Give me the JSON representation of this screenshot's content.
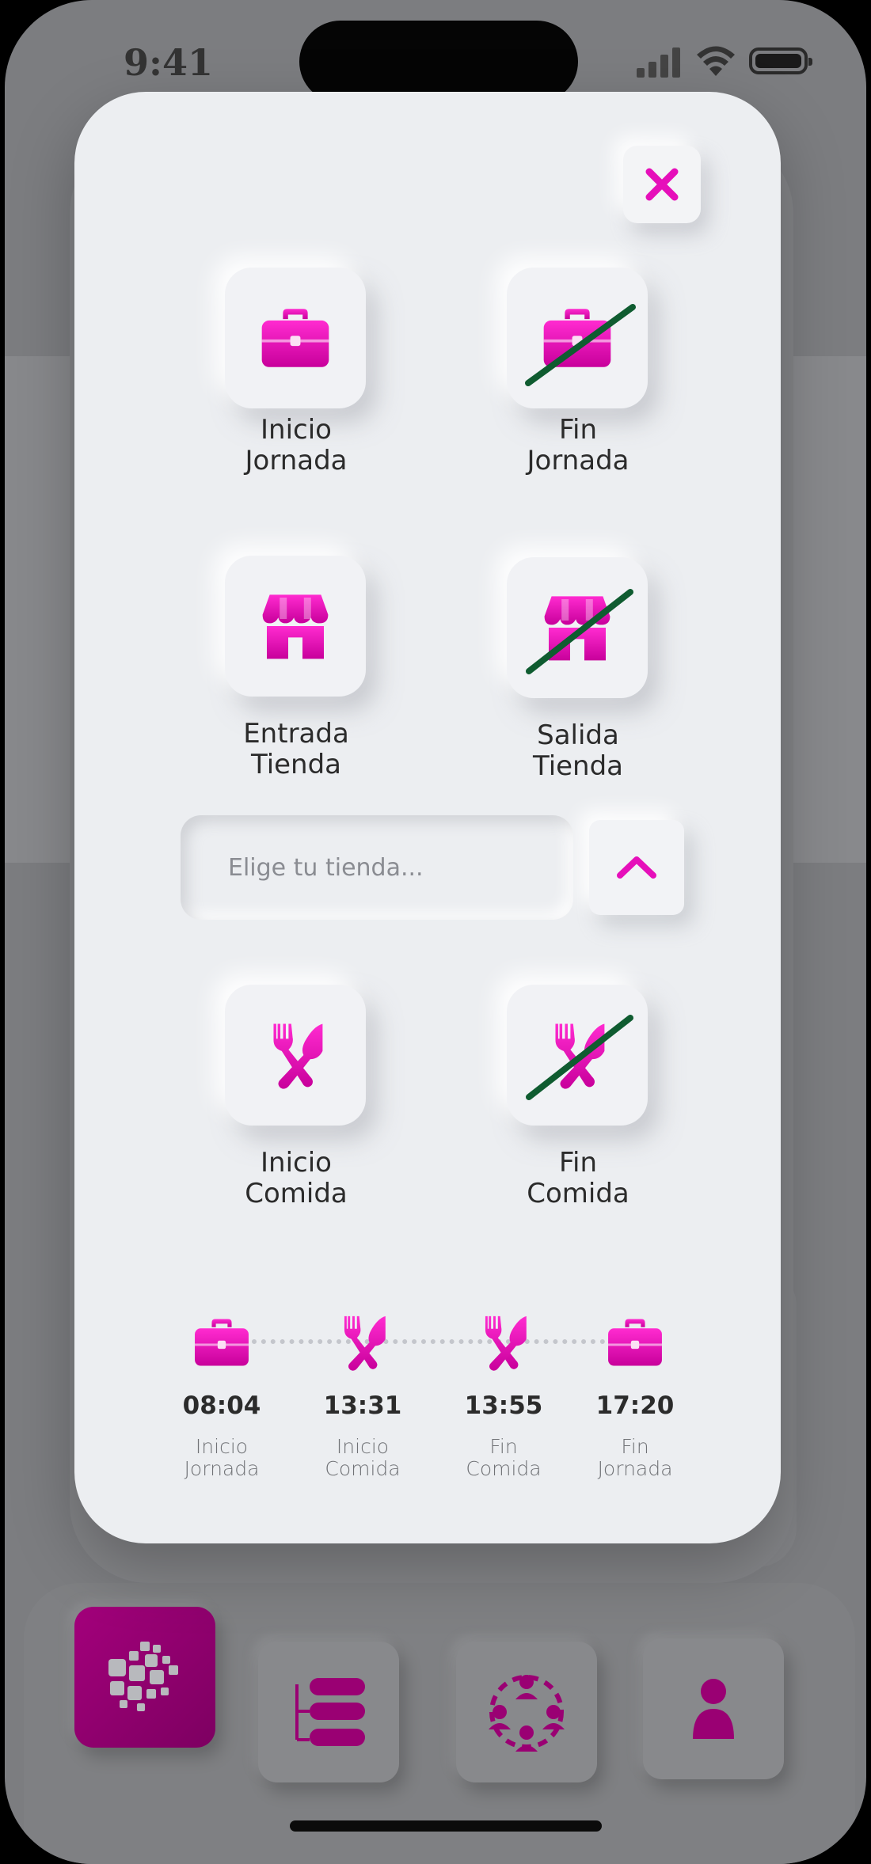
{
  "status_bar": {
    "time": "9:41"
  },
  "colors": {
    "accent": "#e60fba",
    "strike": "#0f5c30",
    "active_nav": "#9a0073"
  },
  "actions": [
    {
      "line1": "Inicio",
      "line2": "Jornada",
      "icon": "briefcase-icon",
      "crossed": false
    },
    {
      "line1": "Fin",
      "line2": "Jornada",
      "icon": "briefcase-icon",
      "crossed": true
    },
    {
      "line1": "Entrada",
      "line2": "Tienda",
      "icon": "store-icon",
      "crossed": false
    },
    {
      "line1": "Salida",
      "line2": "Tienda",
      "icon": "store-icon",
      "crossed": true
    },
    {
      "line1": "Inicio",
      "line2": "Comida",
      "icon": "utensils-icon",
      "crossed": false
    },
    {
      "line1": "Fin",
      "line2": "Comida",
      "icon": "utensils-icon",
      "crossed": true
    }
  ],
  "store_select": {
    "placeholder": "Elige tu tienda...",
    "value": ""
  },
  "timeline": [
    {
      "time": "08:04",
      "line1": "Inicio",
      "line2": "Jornada",
      "icon": "briefcase-icon"
    },
    {
      "time": "13:31",
      "line1": "Inicio",
      "line2": "Comida",
      "icon": "utensils-icon"
    },
    {
      "time": "13:55",
      "line1": "Fin",
      "line2": "Comida",
      "icon": "utensils-icon"
    },
    {
      "time": "17:20",
      "line1": "Fin",
      "line2": "Jornada",
      "icon": "briefcase-icon"
    }
  ],
  "nav": [
    {
      "icon": "dashboard-grid-icon",
      "active": true
    },
    {
      "icon": "list-icon",
      "active": false
    },
    {
      "icon": "team-icon",
      "active": false
    },
    {
      "icon": "profile-icon",
      "active": false
    }
  ]
}
